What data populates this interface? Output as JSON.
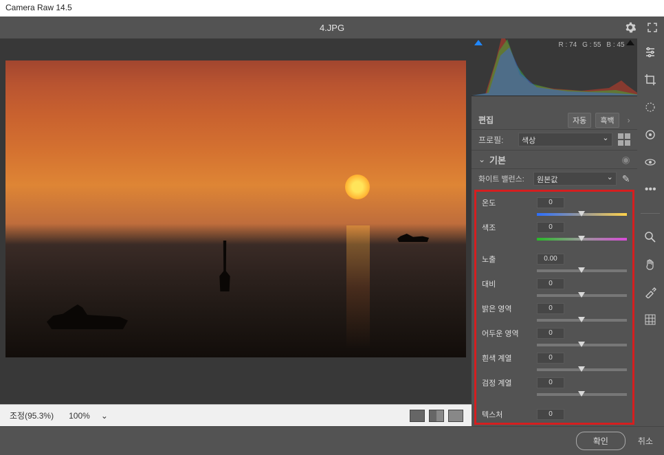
{
  "window": {
    "title": "Camera Raw 14.5"
  },
  "topbar": {
    "filename": "4.JPG"
  },
  "histogram": {
    "r": "R : 74",
    "g": "G : 55",
    "b": "B : 45"
  },
  "edit": {
    "label": "편집",
    "auto": "자동",
    "bw": "흑백"
  },
  "profile": {
    "label": "프로필:",
    "value": "색상"
  },
  "basic": {
    "label": "기본",
    "wb_label": "화이트 밸런스:",
    "wb_value": "원본값",
    "sliders": {
      "temp": {
        "label": "온도",
        "value": "0"
      },
      "tint": {
        "label": "색조",
        "value": "0"
      },
      "exposure": {
        "label": "노출",
        "value": "0.00"
      },
      "contrast": {
        "label": "대비",
        "value": "0"
      },
      "highlights": {
        "label": "밝은 영역",
        "value": "0"
      },
      "shadows": {
        "label": "어두운 영역",
        "value": "0"
      },
      "whites": {
        "label": "흰색 계열",
        "value": "0"
      },
      "blacks": {
        "label": "검정 계열",
        "value": "0"
      },
      "texture": {
        "label": "텍스처",
        "value": "0"
      }
    }
  },
  "bottombar": {
    "status": "조정(95.3%)",
    "zoom": "100%"
  },
  "footer": {
    "ok": "확인",
    "cancel": "취소"
  }
}
